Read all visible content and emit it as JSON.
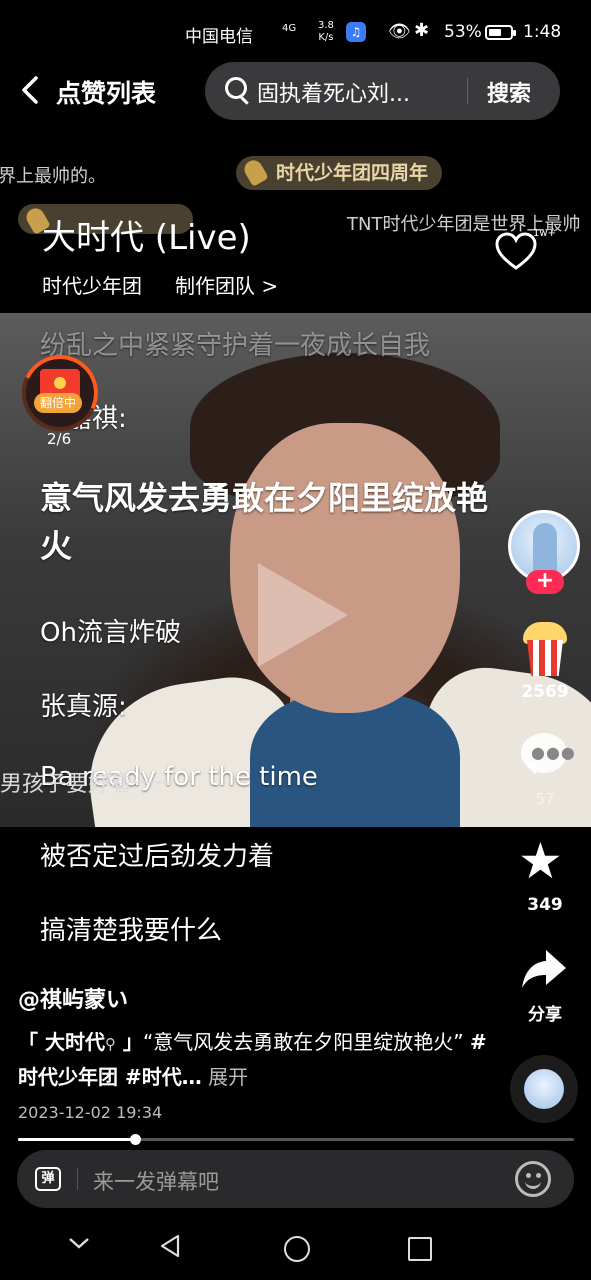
{
  "status_bar": {
    "carrier": "中国电信",
    "network": "4G",
    "speed_value": "3.8",
    "speed_unit": "K/s",
    "battery": "53%",
    "time": "1:48"
  },
  "header": {
    "title": "点赞列表",
    "search_query": "固执着死心刘...",
    "search_button": "搜索"
  },
  "danmaku": {
    "line_1": "界上最帅的。",
    "tag_1": "时代少年团四周年",
    "line_2": "TNT时代少年团是世界上最帅",
    "line_3": "男孩子要好看一一"
  },
  "song": {
    "title": "大时代 (Live)",
    "artist": "时代少年团",
    "team": "制作团队 >",
    "like_count": "1w+"
  },
  "lyrics": {
    "line_0": "纷乱之中紧紧守护着一夜成长自我",
    "line_1": "马嘉祺:",
    "main": "意气风发去勇敢在夕阳里绽放艳火",
    "line_3": "Oh流言炸破",
    "line_4": "张真源:",
    "line_5": "Ba ready for the time",
    "line_6": "被否定过后劲发力着",
    "line_7": "搞清楚我要什么"
  },
  "red_packet": {
    "tag": "翻倍中",
    "count": "2/6"
  },
  "actions": {
    "popcorn_count": "2569",
    "comment_count": "57",
    "favorite_count": "349",
    "share_label": "分享"
  },
  "post": {
    "author": "@祺屿蒙い",
    "caption_quote_open": "「 ",
    "caption_song": "大时代",
    "caption_search_glyph": "⚲",
    "caption_quote_close": " 」",
    "caption_text": "“意气风发去勇敢在夕阳里绽放艳火” ",
    "caption_tag_1": "#时代少年团",
    "caption_tag_2": " #时代…",
    "expand": " 展开",
    "date": "2023-12-02 19:34"
  },
  "progress": {
    "fraction": 0.21
  },
  "danmaku_bar": {
    "toggle_label": "弹",
    "placeholder": "来一发弹幕吧"
  },
  "colors": {
    "accent": "#fe2c55",
    "background": "#000000"
  }
}
